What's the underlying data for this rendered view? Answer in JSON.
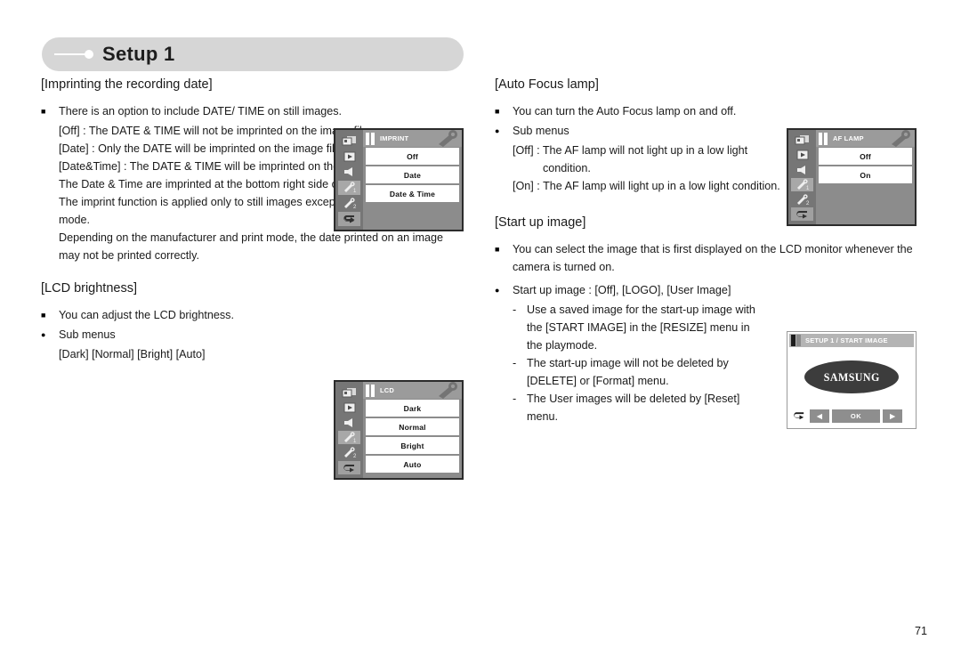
{
  "header": {
    "title": "Setup 1"
  },
  "page_number": "71",
  "left_column": {
    "sections": [
      {
        "title": "[Imprinting the recording date]",
        "bullet1": "There is an option to include DATE/ TIME on still images.",
        "lines": [
          "[Off] : The DATE & TIME will not be imprinted on the image file.",
          "[Date] : Only the DATE will be imprinted on the image file.",
          "[Date&Time] : The DATE & TIME will be imprinted on the image file.",
          "The Date & Time are imprinted at the bottom right side of the still image.",
          "The imprint function is applied only to still images except photo frame effect mode.",
          "Depending on the manufacturer and print mode, the date printed on an image may not be printed correctly."
        ]
      },
      {
        "title": "[LCD brightness]",
        "bullet1": "You can adjust the LCD brightness.",
        "bullet2": "Sub menus",
        "submenu_line": "[Dark] [Normal] [Bright] [Auto]"
      }
    ]
  },
  "right_column": {
    "sections": [
      {
        "title": "[Auto Focus lamp]",
        "bullet1": "You can turn the Auto Focus lamp on and off.",
        "bullet2": "Sub menus",
        "lines": [
          "[Off] : The AF lamp will not light up in a low light condition.",
          "[On] : The AF lamp will light up in a low light condition."
        ]
      },
      {
        "title": "[Start up image]",
        "bullet1": "You can select the image that is first displayed on the LCD monitor whenever the camera is turned on.",
        "bullet2": "Start up image : [Off], [LOGO], [User Image]",
        "dash_items": [
          "Use a saved image for the start-up image with the [START IMAGE] in the [RESIZE] menu in the playmode.",
          "The start-up image will not be deleted by [DELETE] or [Format] menu.",
          "The User images will be deleted by [Reset] menu."
        ]
      }
    ]
  },
  "lcd_screens": {
    "imprint": {
      "title": "IMPRINT",
      "items": [
        "Off",
        "Date",
        "Date & Time"
      ]
    },
    "lcd_brightness": {
      "title": "LCD",
      "items": [
        "Dark",
        "Normal",
        "Bright",
        "Auto"
      ]
    },
    "af_lamp": {
      "title": "AF LAMP",
      "items": [
        "Off",
        "On"
      ]
    },
    "start_image": {
      "title": "SETUP 1  / START IMAGE",
      "logo_text": "SAMSUNG",
      "buttons": {
        "left": "◀",
        "ok": "OK",
        "right": "▶"
      }
    }
  },
  "colors": {
    "header_pill": "#d6d6d6",
    "lcd_bg": "#8c8c8c",
    "lcd_sidebar": "#767676",
    "lcd_titlebar": "#9b9b9b",
    "lcd_item_bg": "#ffffff",
    "text": "#1a1a1a"
  }
}
